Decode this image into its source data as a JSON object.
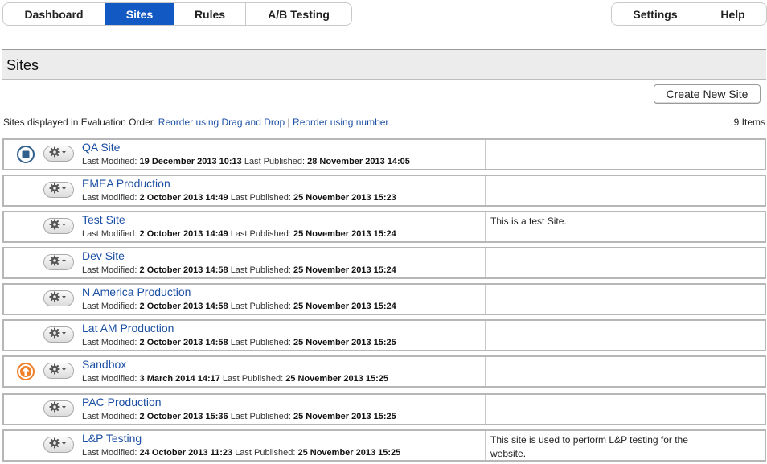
{
  "tabs_left": [
    "Dashboard",
    "Sites",
    "Rules",
    "A/B Testing"
  ],
  "tabs_right": [
    "Settings",
    "Help"
  ],
  "active_tab": "Sites",
  "page_title": "Sites",
  "create_button": "Create New Site",
  "info": {
    "prefix": "Sites displayed in Evaluation Order.",
    "link_drag": "Reorder using Drag and Drop",
    "separator": "|",
    "link_number": "Reorder using number",
    "count": "9 Items"
  },
  "labels": {
    "last_modified": "Last Modified:",
    "last_published": "Last Published:"
  },
  "colors": {
    "active_tab": "#1359c4",
    "link": "#1b4fa3",
    "stop_icon": "#2f5f8a",
    "upload_icon": "#f07f2a"
  },
  "sites": [
    {
      "name": "QA Site",
      "modified": "19 December 2013 10:13",
      "published": "28 November 2013 14:05",
      "description": "",
      "status": "stop"
    },
    {
      "name": "EMEA Production",
      "modified": "2 October 2013 14:49",
      "published": "25 November 2013 15:23",
      "description": "",
      "status": ""
    },
    {
      "name": "Test Site",
      "modified": "2 October 2013 14:49",
      "published": "25 November 2013 15:24",
      "description": "This is a test Site.",
      "status": ""
    },
    {
      "name": "Dev Site",
      "modified": "2 October 2013 14:58",
      "published": "25 November 2013 15:24",
      "description": "",
      "status": ""
    },
    {
      "name": "N America Production",
      "modified": "2 October 2013 14:58",
      "published": "25 November 2013 15:24",
      "description": "",
      "status": ""
    },
    {
      "name": "Lat AM Production",
      "modified": "2 October 2013 14:58",
      "published": "25 November 2013 15:25",
      "description": "",
      "status": ""
    },
    {
      "name": "Sandbox",
      "modified": "3 March 2014 14:17",
      "published": "25 November 2013 15:25",
      "description": "",
      "status": "upload"
    },
    {
      "name": "PAC Production",
      "modified": "2 October 2013 15:36",
      "published": "25 November 2013 15:25",
      "description": "",
      "status": ""
    },
    {
      "name": "L&P Testing",
      "modified": "24 October 2013 11:23",
      "published": "25 November 2013 15:25",
      "description": "This site is used to perform L&P testing for the website.",
      "status": ""
    }
  ]
}
